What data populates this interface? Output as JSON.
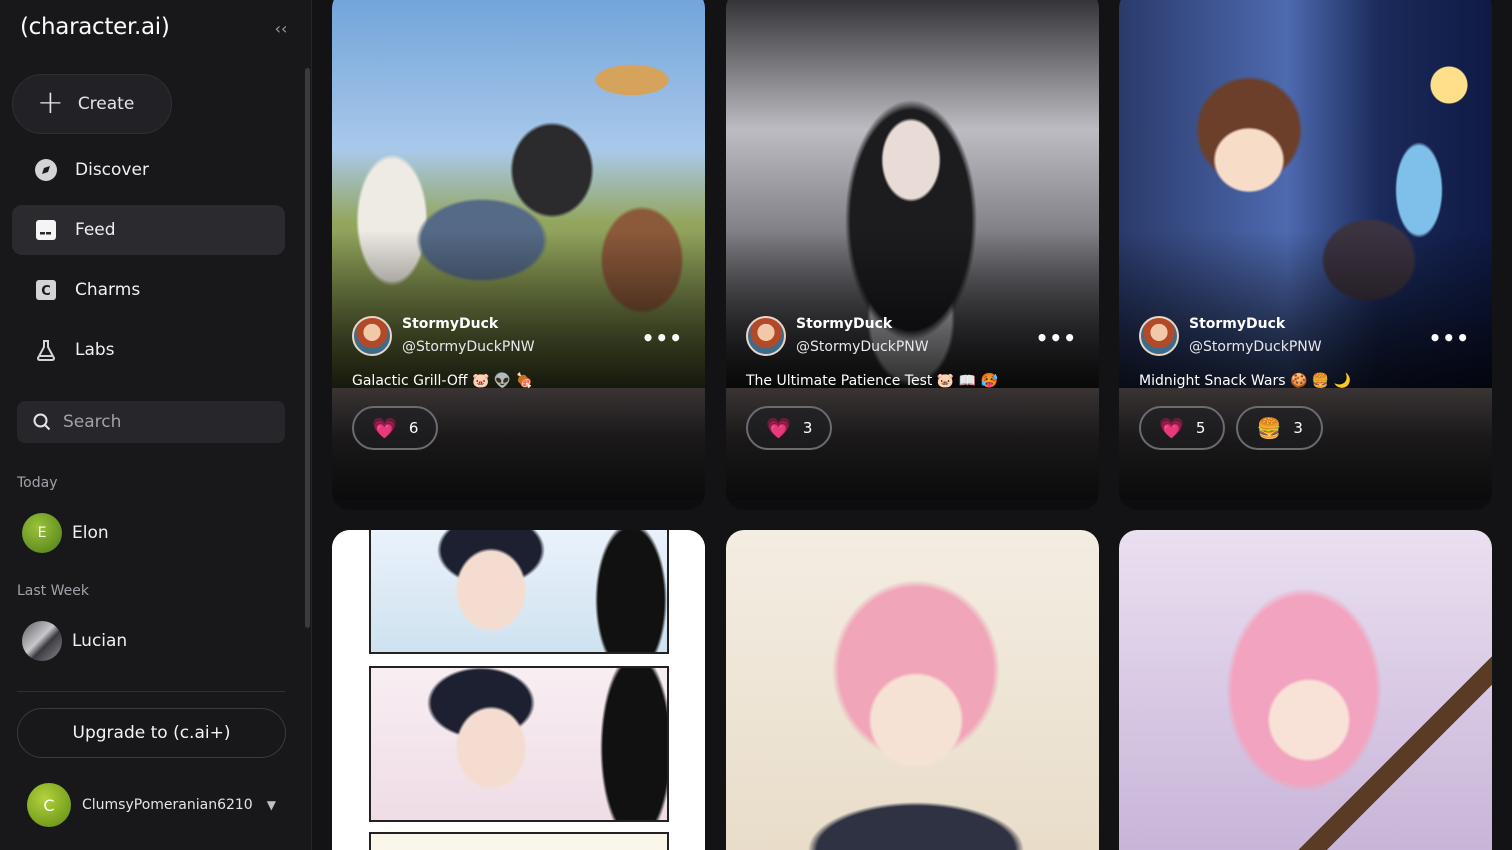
{
  "app": {
    "logo": "(character.ai)"
  },
  "sidebar": {
    "create_label": "Create",
    "nav": [
      {
        "label": "Discover",
        "icon": "compass-icon"
      },
      {
        "label": "Feed",
        "icon": "feed-icon"
      },
      {
        "label": "Charms",
        "icon": "charms-icon"
      },
      {
        "label": "Labs",
        "icon": "flask-icon"
      }
    ],
    "search_placeholder": "Search",
    "sections": [
      {
        "title": "Today",
        "chats": [
          {
            "name": "Elon",
            "initial": "E"
          }
        ]
      },
      {
        "title": "Last Week",
        "chats": [
          {
            "name": "Lucian",
            "initial": ""
          }
        ]
      }
    ],
    "upgrade_label": "Upgrade to (c.ai+)",
    "user": {
      "name": "ClumsyPomeranian6210",
      "initial": "C"
    }
  },
  "feed": {
    "posts": [
      {
        "author_name": "StormyDuck",
        "author_handle": "@StormyDuckPNW",
        "caption": "Galactic Grill-Off 🐷 👽 🍖",
        "reactions": [
          {
            "emoji": "heart",
            "count": "6"
          }
        ]
      },
      {
        "author_name": "StormyDuck",
        "author_handle": "@StormyDuckPNW",
        "caption": "The Ultimate Patience Test 🐷 📖 🥵",
        "reactions": [
          {
            "emoji": "heart",
            "count": "3"
          }
        ]
      },
      {
        "author_name": "StormyDuck",
        "author_handle": "@StormyDuckPNW",
        "caption": "Midnight Snack Wars 🍪 🍔 🌙",
        "reactions": [
          {
            "emoji": "heart",
            "count": "5"
          },
          {
            "emoji": "burger",
            "count": "3"
          }
        ]
      }
    ]
  },
  "colors": {
    "accent_heart": "#f5489a",
    "sidebar_bg": "#18181b",
    "active_nav": "#2a2a2f"
  }
}
